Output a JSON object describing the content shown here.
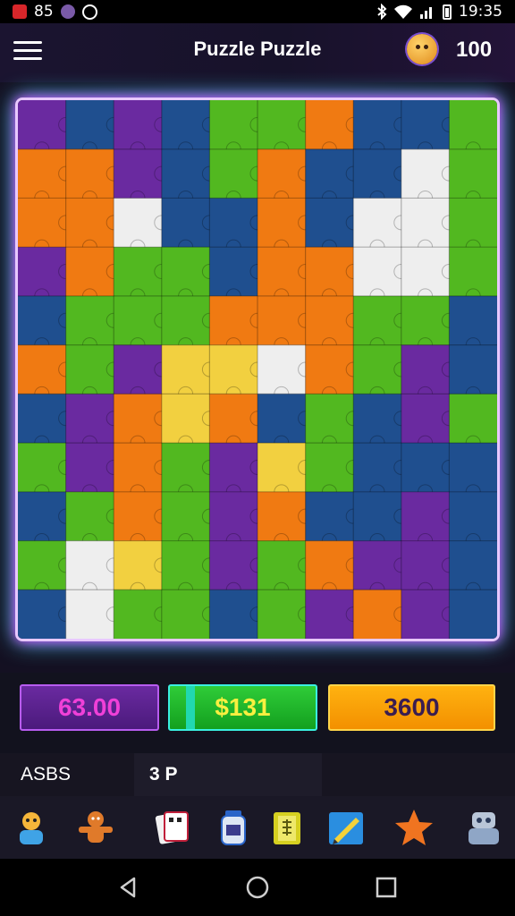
{
  "status_bar": {
    "notification_text": "85",
    "time": "19:35",
    "icons": [
      "app-notification-icon",
      "app-notification-icon",
      "circle-icon",
      "bluetooth-icon",
      "wifi-icon",
      "signal-icon",
      "battery-icon"
    ]
  },
  "header": {
    "menu_icon": "hamburger-icon",
    "title": "Puzzle Puzzle",
    "avatar_icon": "character-avatar-icon",
    "score": "100"
  },
  "board": {
    "description_icon": "jigsaw-puzzle-board",
    "colors": {
      "border_glow_1": "#e040ff",
      "border_glow_2": "#40e0ff",
      "purple": "#6a2aa0",
      "orange": "#f07a12",
      "green": "#52b820",
      "blue": "#1f4f8f",
      "yellow": "#f2d040",
      "white": "#eeeeee"
    }
  },
  "counters": {
    "purple_value": "63.00",
    "green_value": "$131",
    "orange_value": "3600"
  },
  "info_row": {
    "left_label": "ASBS",
    "chip_label": "3 P"
  },
  "tray": {
    "items": [
      {
        "icon": "character-icon"
      },
      {
        "icon": "gingerbread-icon"
      },
      {
        "icon": "cards-icon"
      },
      {
        "icon": "jar-icon"
      },
      {
        "icon": "ticket-icon"
      },
      {
        "icon": "pencil-icon"
      },
      {
        "icon": "star-icon"
      },
      {
        "icon": "robot-icon"
      }
    ]
  },
  "nav_bar": {
    "icons": [
      "back-icon",
      "home-icon",
      "recents-icon"
    ]
  }
}
